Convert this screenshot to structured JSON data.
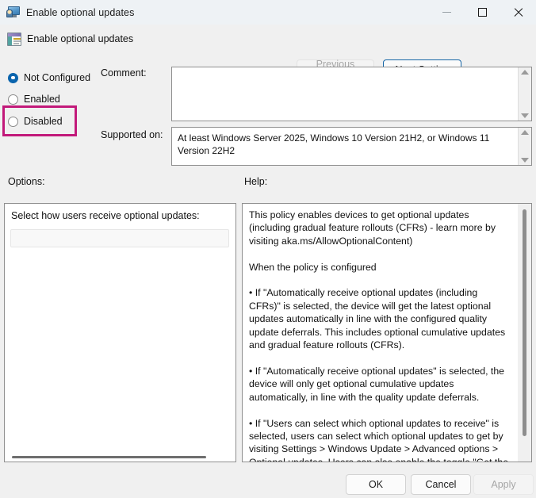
{
  "window": {
    "title": "Enable optional updates",
    "icon": "policy-computer-icon",
    "controls": {
      "minimize": "minimize-icon",
      "maximize": "maximize-icon",
      "close": "close-icon"
    }
  },
  "header": {
    "policy_name": "Enable optional updates",
    "icon": "policy-setting-icon",
    "previous_setting_label": "Previous Setting",
    "next_setting_label": "Next Setting",
    "previous_setting_enabled": false,
    "next_setting_focused": true
  },
  "state": {
    "options": [
      {
        "label": "Not Configured",
        "selected": true,
        "highlighted": false
      },
      {
        "label": "Enabled",
        "selected": false,
        "highlighted": false
      },
      {
        "label": "Disabled",
        "selected": false,
        "highlighted": true
      }
    ],
    "highlight_color": "#c2197a"
  },
  "fields": {
    "comment_label": "Comment:",
    "comment_value": "",
    "supported_on_label": "Supported on:",
    "supported_on_value": "At least Windows Server 2025, Windows 10 Version 21H2, or Windows 11 Version 22H2"
  },
  "options_pane": {
    "section_label": "Options:",
    "setting_label": "Select how users receive optional updates:",
    "combobox_value": "",
    "combobox_enabled": false
  },
  "help_pane": {
    "section_label": "Help:",
    "text": "This policy enables devices to get optional updates (including gradual feature rollouts (CFRs) - learn more by visiting aka.ms/AllowOptionalContent)\n\nWhen the policy is configured\n\n• If \"Automatically receive optional updates (including CFRs)\" is selected, the device will get the latest optional updates automatically in line with the configured quality update deferrals. This includes optional cumulative updates and gradual feature rollouts (CFRs).\n\n• If \"Automatically receive optional updates\" is selected, the device will only get optional cumulative updates automatically, in line with the quality update deferrals.\n\n• If \"Users can select which optional updates to receive\" is selected, users can select which optional updates to get by visiting Settings > Windows Update > Advanced options > Optional updates. Users can also enable the toggle \"Get the latest updates as soon as they're available\" to automatically receive"
  },
  "footer": {
    "ok_label": "OK",
    "cancel_label": "Cancel",
    "apply_label": "Apply",
    "apply_enabled": false
  }
}
